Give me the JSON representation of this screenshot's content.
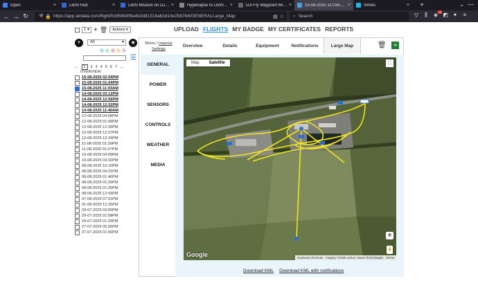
{
  "browser": {
    "tabs": [
      {
        "title": "Open",
        "favicon_color": "#3b82f6",
        "active": false
      },
      {
        "title": "Litchi Hub",
        "favicon_color": "#2f6ad8",
        "active": false
      },
      {
        "title": "Litchi Mission on DJI Mi...",
        "favicon_color": "#2f6ad8",
        "active": false
      },
      {
        "title": "Hyperlapse to Litchi Wa...",
        "favicon_color": "#888888",
        "active": false
      },
      {
        "title": "DJI Fly Waypoint Mission...",
        "favicon_color": "#666666",
        "active": false
      },
      {
        "title": "15-08-2025 11:03AM | Ai...",
        "favicon_color": "#4aa3df",
        "active": true
      },
      {
        "title": "Vimeo",
        "favicon_color": "#1ab7ea",
        "active": false
      }
    ],
    "url": "https://app.airdata.com/flight/fcbf5894f9a4b2d81318a62d13e25b7b6/GENERALLarge_Map",
    "search_placeholder": "Search",
    "notif_count": "10"
  },
  "toolbar": {
    "count_select": "1",
    "actions_label": "Actions"
  },
  "filters": {
    "drop_label": "All",
    "dot_colors": [
      "#b8d8f0",
      "#b8f0c8",
      "#f0b8c8",
      "#f0e0a8",
      "#d8c8f0"
    ]
  },
  "pager": {
    "prev": "←",
    "pages": [
      "1",
      "2",
      "3",
      "4",
      "5",
      "6",
      "7"
    ],
    "next": "→"
  },
  "overview_label": "OVERVIEW",
  "flights": [
    {
      "label": "15-08-2025 02:54PM",
      "style": "bold",
      "checked": false
    },
    {
      "label": "15-08-2025 01:04PM",
      "style": "bold",
      "checked": false
    },
    {
      "label": "15-08-2025 11:03AM",
      "style": "sel",
      "checked": true
    },
    {
      "label": "14-08-2025 03:12PM",
      "style": "bold",
      "checked": false
    },
    {
      "label": "14-08-2025 12:56PM",
      "style": "bold",
      "checked": false
    },
    {
      "label": "14-08-2025 12:52PM",
      "style": "bold",
      "checked": false
    },
    {
      "label": "14-08-2025 11:40AM",
      "style": "bold",
      "checked": false
    },
    {
      "label": "12-08-2025 04:08PM",
      "style": "",
      "checked": false
    },
    {
      "label": "12-08-2025 01:09PM",
      "style": "",
      "checked": false
    },
    {
      "label": "12-08-2025 12:39PM",
      "style": "",
      "checked": false
    },
    {
      "label": "12-08-2025 12:27PM",
      "style": "",
      "checked": false
    },
    {
      "label": "12-08-2025 12:24PM",
      "style": "",
      "checked": false
    },
    {
      "label": "11-08-2025 01:39PM",
      "style": "",
      "checked": false
    },
    {
      "label": "11-08-2025 01:07PM",
      "style": "",
      "checked": false
    },
    {
      "label": "10-08-2025 04:09PM",
      "style": "",
      "checked": false
    },
    {
      "label": "10-08-2025 03:32PM",
      "style": "",
      "checked": false
    },
    {
      "label": "08-08-2025 10:10PM",
      "style": "",
      "checked": false
    },
    {
      "label": "08-08-2025 04:21PM",
      "style": "",
      "checked": false
    },
    {
      "label": "08-08-2025 01:46PM",
      "style": "",
      "checked": false
    },
    {
      "label": "08-08-2025 01:29PM",
      "style": "",
      "checked": false
    },
    {
      "label": "08-08-2025 01:26PM",
      "style": "",
      "checked": false
    },
    {
      "label": "08-08-2025 12:43PM",
      "style": "",
      "checked": false
    },
    {
      "label": "07-08-2025 07:52PM",
      "style": "",
      "checked": false
    },
    {
      "label": "01-08-2025 12:25PM",
      "style": "",
      "checked": false
    },
    {
      "label": "29-07-2025 03:00PM",
      "style": "",
      "checked": false
    },
    {
      "label": "29-07-2025 01:58PM",
      "style": "",
      "checked": false
    },
    {
      "label": "29-07-2025 01:33PM",
      "style": "",
      "checked": false
    },
    {
      "label": "27-07-2025 05:05PM",
      "style": "",
      "checked": false
    },
    {
      "label": "27-07-2025 01:00PM",
      "style": "",
      "checked": false
    }
  ],
  "topnav": [
    "UPLOAD",
    "FLIGHTS",
    "MY BADGE",
    "MY CERTIFICATES",
    "REPORTS"
  ],
  "topnav_active": "FLIGHTS",
  "units": {
    "metric": "Metric",
    "sep": "/",
    "imperial": "Imperial",
    "settings": "Settings"
  },
  "tabs": [
    "Overview",
    "Details",
    "Equipment",
    "Notifications",
    "Large Map"
  ],
  "tab_active": "Large Map",
  "sidemenu": [
    "GENERAL",
    "POWER",
    "SENSORS",
    "CONTROLS",
    "WEATHER",
    "MEDIA"
  ],
  "sidemenu_active": "GENERAL",
  "map": {
    "type_map": "Map",
    "type_satellite": "Satellite",
    "active_type": "Satellite",
    "google": "Google",
    "attrib": [
      "Keyboard shortcuts",
      "Imagery ©2025 Airbus, Maxar Technologies",
      "Terms"
    ],
    "path_color": "#f2e61a"
  },
  "downloads": {
    "kml": "Download KML",
    "kml_notif": "Download KML with notifications"
  }
}
